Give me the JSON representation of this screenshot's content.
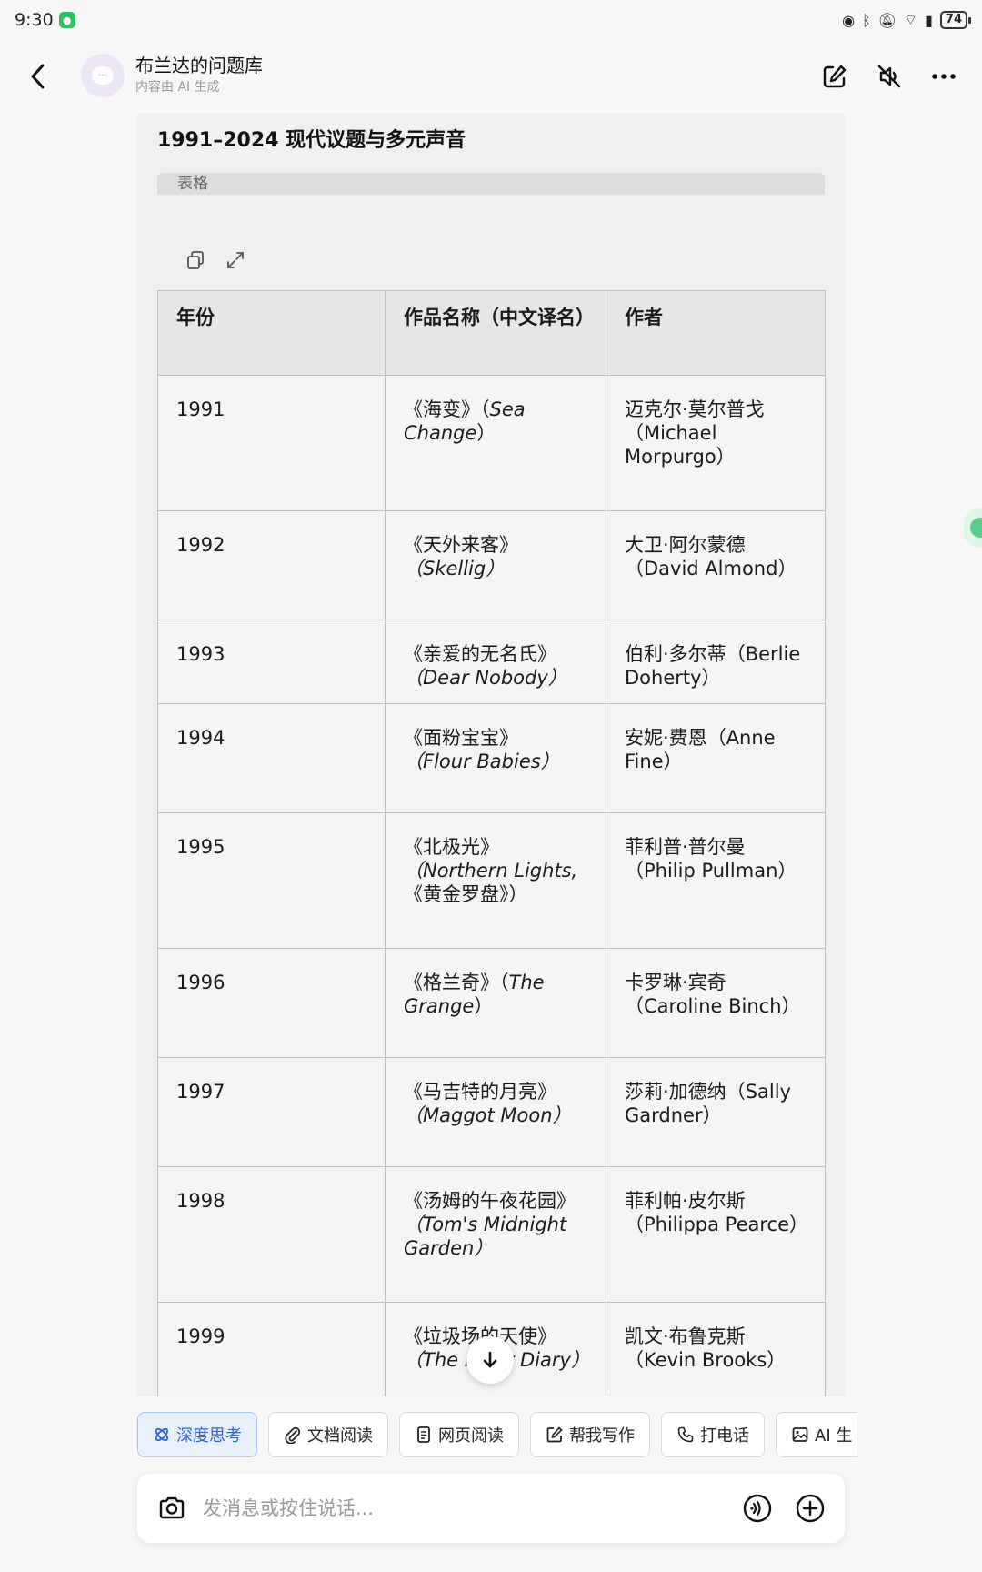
{
  "status": {
    "time": "9:30",
    "battery": "74"
  },
  "header": {
    "title": "布兰达的问题库",
    "subtitle": "内容由 AI 生成"
  },
  "content": {
    "section_title": "1991–2024 现代议题与多元声音",
    "table_tab_label": "表格",
    "table": {
      "headers": [
        "年份",
        "作品名称（中文译名）",
        "作者"
      ],
      "rows": [
        {
          "year": "1991",
          "work_cn": "《海变》（",
          "work_en": "Sea Change",
          "work_tail": "）",
          "author_cn": "迈克尔·莫尔普戈",
          "author_en": "（Michael Morpurgo）"
        },
        {
          "year": "1992",
          "work_cn": "《天外来客》",
          "work_en": "（Skellig）",
          "work_tail": "",
          "author_cn": "大卫·阿尔蒙德",
          "author_en": "（David Almond）"
        },
        {
          "year": "1993",
          "work_cn": "《亲爱的无名氏》",
          "work_en": "（Dear Nobody）",
          "work_tail": "",
          "author_cn": "伯利·多尔蒂",
          "author_en": "（Berlie Doherty）"
        },
        {
          "year": "1994",
          "work_cn": "《面粉宝宝》",
          "work_en": "（Flour Babies）",
          "work_tail": "",
          "author_cn": "安妮·费恩",
          "author_en": "（Anne Fine）"
        },
        {
          "year": "1995",
          "work_cn": "《北极光》",
          "work_en": "（Northern Lights,",
          "work_tail": "《黄金罗盘》）",
          "author_cn": "菲利普·普尔曼",
          "author_en": "（Philip Pullman）"
        },
        {
          "year": "1996",
          "work_cn": "《格兰奇》（",
          "work_en": "The Grange",
          "work_tail": "）",
          "author_cn": "卡罗琳·宾奇",
          "author_en": "（Caroline Binch）"
        },
        {
          "year": "1997",
          "work_cn": "《马吉特的月亮》",
          "work_en": "（Maggot Moon）",
          "work_tail": "",
          "author_cn": "莎莉·加德纳",
          "author_en": "（Sally Gardner）"
        },
        {
          "year": "1998",
          "work_cn": "《汤姆的午夜花园》",
          "work_en": "（Tom's Midnight Garden）",
          "work_tail": "",
          "author_cn": "菲利帕·皮尔斯",
          "author_en": "（Philippa Pearce）"
        },
        {
          "year": "1999",
          "work_cn": "《垃圾场的天使》",
          "work_en": "（The F…er Diary）",
          "work_tail": "",
          "author_cn": "凯文·布鲁克斯",
          "author_en": "（Kevin Brooks）"
        }
      ]
    }
  },
  "chips": [
    {
      "label": "深度思考",
      "icon": "deep-think-icon"
    },
    {
      "label": "文档阅读",
      "icon": "paperclip-icon"
    },
    {
      "label": "网页阅读",
      "icon": "web-page-icon"
    },
    {
      "label": "帮我写作",
      "icon": "edit-icon"
    },
    {
      "label": "打电话",
      "icon": "phone-icon"
    },
    {
      "label": "AI 生",
      "icon": "image-icon"
    }
  ],
  "composer": {
    "placeholder": "发消息或按住说话..."
  }
}
